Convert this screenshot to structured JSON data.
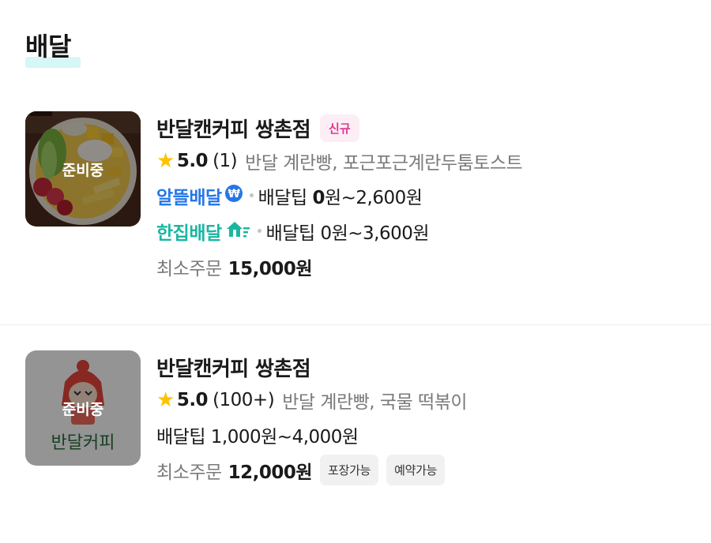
{
  "section": {
    "title": "배달"
  },
  "stores": [
    {
      "name": "반달캔커피 쌍촌점",
      "badge": "신규",
      "status": "준비중",
      "rating": "5.0",
      "review_count": "(1)",
      "menu": "반달 계란빵, 포근포근계란두툼토스트",
      "deliveries": [
        {
          "service": "알뜰배달",
          "icon": "won-coin-icon",
          "tip_label": "배달팁",
          "tip_zero": "0",
          "tip_rest": "원~2,600원"
        },
        {
          "service": "한집배달",
          "icon": "home-arrow-icon",
          "tip_label": "배달팁",
          "tip_range": "0원~3,600원"
        }
      ],
      "min_order_label": "최소주문",
      "min_order": "15,000원"
    },
    {
      "name": "반달캔커피 쌍촌점",
      "status": "준비중",
      "logo_text": "반달커피",
      "rating": "5.0",
      "review_count": "(100+)",
      "menu": "반달 계란빵, 국물 떡볶이",
      "delivery_tip": "배달팁 1,000원~4,000원",
      "min_order_label": "최소주문",
      "min_order": "12,000원",
      "tags": [
        "포장가능",
        "예약가능"
      ]
    }
  ],
  "colors": {
    "alddeul": "#2577e8",
    "hanjib": "#1bb6a2",
    "star": "#ffc200",
    "badge_new": "#e0378f"
  }
}
